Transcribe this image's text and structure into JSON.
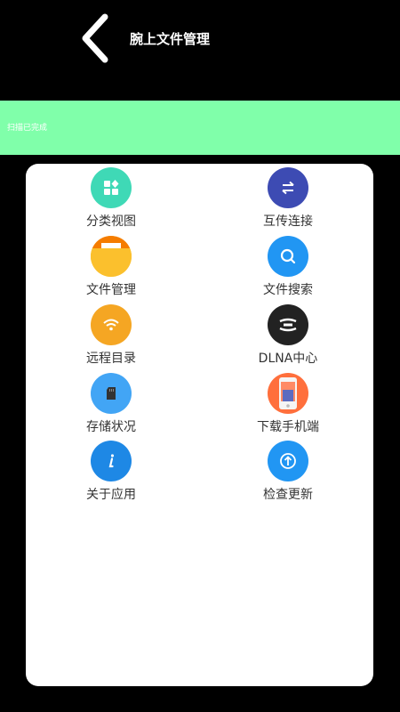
{
  "header": {
    "title": "腕上文件管理"
  },
  "status": {
    "text": "扫描已完成"
  },
  "menu": [
    {
      "label": "分类视图",
      "icon": "grid-icon",
      "color": "#3fd9b6"
    },
    {
      "label": "互传连接",
      "icon": "transfer-icon",
      "color": "#3d4bb3"
    },
    {
      "label": "文件管理",
      "icon": "folder-icon",
      "color": "#fbc02d"
    },
    {
      "label": "文件搜索",
      "icon": "search-icon",
      "color": "#2196f3"
    },
    {
      "label": "远程目录",
      "icon": "wifi-icon",
      "color": "#f5a623"
    },
    {
      "label": "DLNA中心",
      "icon": "dlna-icon",
      "color": "#222222"
    },
    {
      "label": "存储状况",
      "icon": "sd-card-icon",
      "color": "#42a5f5"
    },
    {
      "label": "下载手机端",
      "icon": "phone-icon",
      "color": "#ff6f3c"
    },
    {
      "label": "关于应用",
      "icon": "info-icon",
      "color": "#1e88e5"
    },
    {
      "label": "检查更新",
      "icon": "update-icon",
      "color": "#2196f3"
    }
  ]
}
